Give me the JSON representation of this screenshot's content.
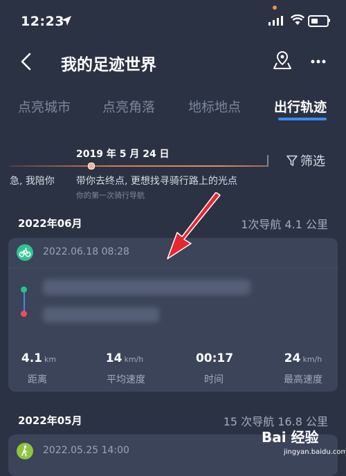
{
  "status_bar": {
    "time": "12:23"
  },
  "header": {
    "title": "我的足迹世界"
  },
  "tabs": [
    {
      "label": "点亮城市"
    },
    {
      "label": "点亮角落"
    },
    {
      "label": "地标地点"
    },
    {
      "label": "出行轨迹"
    }
  ],
  "banner": {
    "date": "2019 年 5 月 24 日",
    "main_left": "急, 我陪你",
    "main": "带你去终点, 更想找寻骑行路上的光点",
    "sub": "你的第一次骑行导航"
  },
  "filter": {
    "label": "筛选"
  },
  "months": [
    {
      "title": "2022年06月",
      "stats": "1次导航  4.1 公里"
    },
    {
      "title": "2022年05月",
      "stats": "15 次导航  16.8 公里"
    }
  ],
  "trip_card": {
    "datetime": "2022.06.18 08:28",
    "stats": [
      {
        "value": "4.1",
        "unit": "km",
        "label": "距离"
      },
      {
        "value": "14",
        "unit": "km/h",
        "label": "平均速度"
      },
      {
        "value": "00:17",
        "unit": "",
        "label": "时间"
      },
      {
        "value": "24",
        "unit": "km/h",
        "label": "最高速度"
      }
    ]
  },
  "trip_card_2": {
    "datetime": "2022.05.25 14:00"
  },
  "watermark": {
    "brand": "Bai 经验",
    "url": "jingyan.baidu.com"
  },
  "colors": {
    "background": "#2b3244",
    "card": "#3b4459",
    "accent_blue": "#3d8bf3",
    "bike_green": "#2dc58f",
    "walk_green": "#8cc63f",
    "timeline_orange": "#e9764a",
    "annotation_red": "#e8262f"
  },
  "icons": [
    "location-arrow-icon",
    "signal-icon",
    "wifi-icon",
    "battery-icon",
    "back-icon",
    "map-pin-icon",
    "more-icon",
    "filter-icon",
    "bike-icon",
    "walk-icon",
    "annotation-arrow-icon"
  ]
}
